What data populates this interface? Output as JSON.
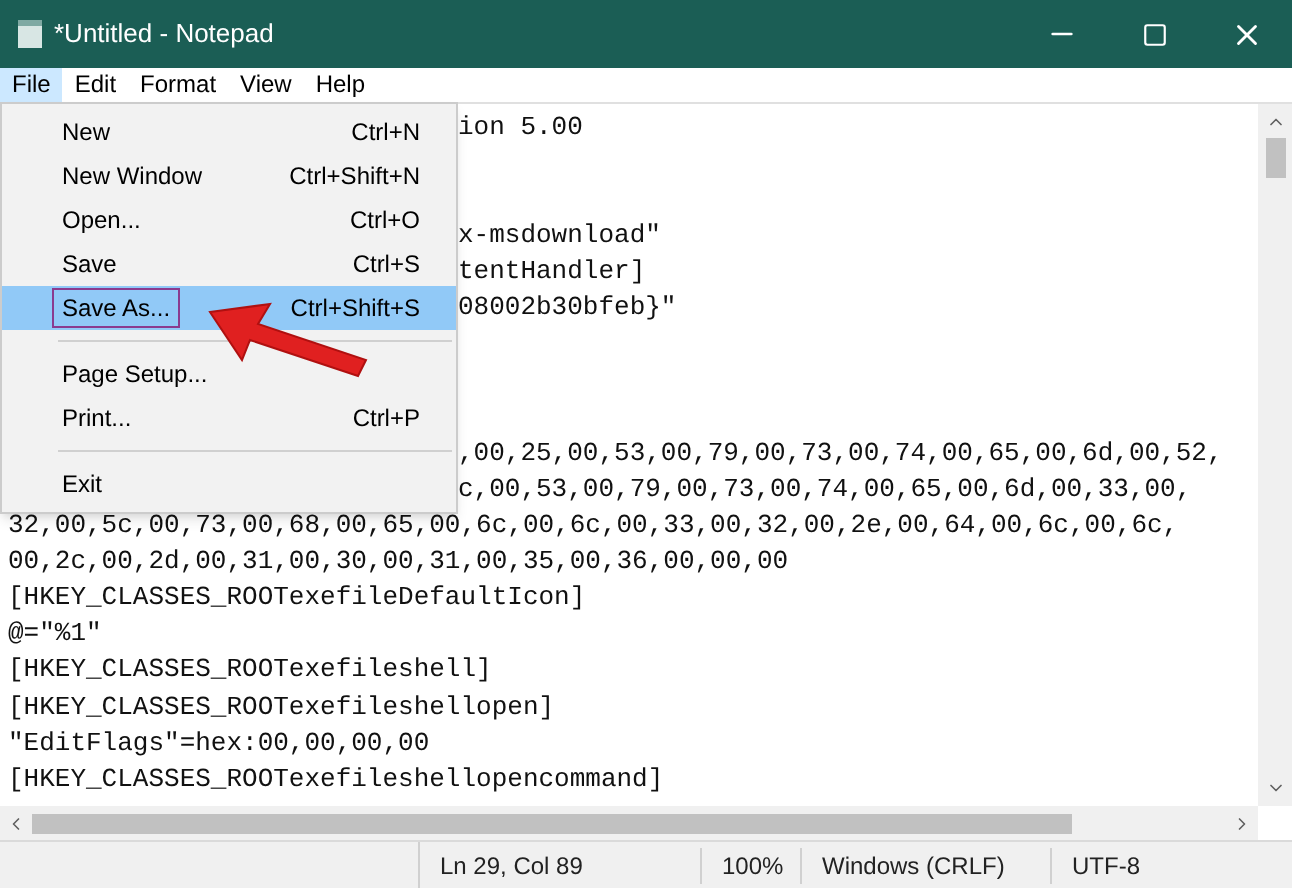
{
  "window": {
    "title": "*Untitled - Notepad"
  },
  "menu_bar": [
    {
      "label": "File",
      "selected": true
    },
    {
      "label": "Edit",
      "selected": false
    },
    {
      "label": "Format",
      "selected": false
    },
    {
      "label": "View",
      "selected": false
    },
    {
      "label": "Help",
      "selected": false
    }
  ],
  "file_menu": [
    {
      "kind": "item",
      "label": "New",
      "shortcut": "Ctrl+N",
      "selected": false
    },
    {
      "kind": "item",
      "label": "New Window",
      "shortcut": "Ctrl+Shift+N",
      "selected": false
    },
    {
      "kind": "item",
      "label": "Open...",
      "shortcut": "Ctrl+O",
      "selected": false
    },
    {
      "kind": "item",
      "label": "Save",
      "shortcut": "Ctrl+S",
      "selected": false
    },
    {
      "kind": "item",
      "label": "Save As...",
      "shortcut": "Ctrl+Shift+S",
      "selected": true
    },
    {
      "kind": "separator"
    },
    {
      "kind": "item",
      "label": "Page Setup...",
      "selected": false
    },
    {
      "kind": "item",
      "label": "Print...",
      "shortcut": "Ctrl+P",
      "selected": false
    },
    {
      "kind": "separator"
    },
    {
      "kind": "item",
      "label": "Exit",
      "selected": false
    }
  ],
  "lines_beside_menu": [
    {
      "kind": "text",
      "text": "ion 5.00"
    },
    {
      "kind": "blank"
    },
    {
      "kind": "blank"
    },
    {
      "kind": "text",
      "text": "x-msdownload\""
    },
    {
      "kind": "text",
      "text": "tentHandler]"
    },
    {
      "kind": "text",
      "text": "08002b30bfeb}\""
    },
    {
      "kind": "blank"
    },
    {
      "kind": "blank"
    },
    {
      "kind": "blank"
    },
    {
      "kind": "text",
      "text": ",00,25,00,53,00,79,00,73,00,74,00,65,00,6d,00,52,"
    },
    {
      "kind": "text",
      "text": "c,00,53,00,79,00,73,00,74,00,65,00,6d,00,33,00,"
    }
  ],
  "lines": [
    "32,00,5c,00,73,00,68,00,65,00,6c,00,6c,00,33,00,32,00,2e,00,64,00,6c,00,6c,",
    "00,2c,00,2d,00,31,00,30,00,31,00,35,00,36,00,00,00",
    "[HKEY_CLASSES_ROOTexefileDefaultIcon]",
    "@=\"%1\"",
    "[HKEY_CLASSES_ROOTexefileshell]",
    "[HKEY_CLASSES_ROOTexefileshellopen]",
    "\"EditFlags\"=hex:00,00,00,00",
    "[HKEY_CLASSES_ROOTexefileshellopencommand]"
  ],
  "status_bar": {
    "position": "Ln 29, Col 89",
    "zoom": "100%",
    "line_endings": "Windows (CRLF)",
    "encoding": "UTF-8"
  }
}
